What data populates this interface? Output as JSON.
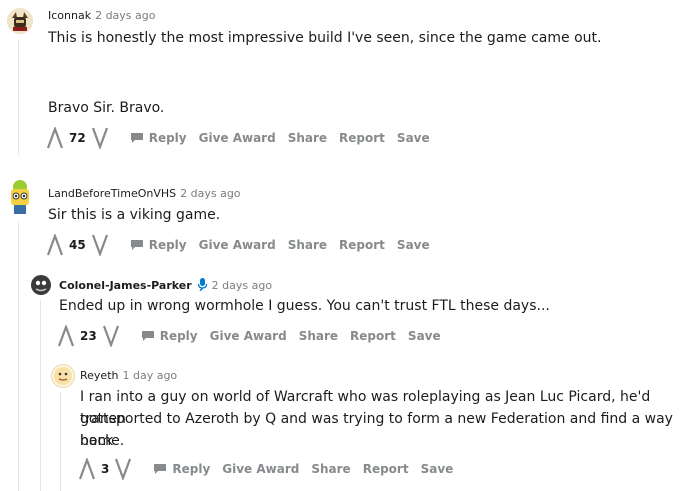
{
  "comments": [
    {
      "author": "Iconnak",
      "time": "2 days ago",
      "lines": [
        "This is honestly the most impressive build I've seen, since the game came out.",
        "Bravo Sir. Bravo."
      ],
      "score": "72"
    },
    {
      "author": "LandBeforeTimeOnVHS",
      "time": "2 days ago",
      "lines": [
        "Sir this is a viking game."
      ],
      "score": "45"
    },
    {
      "author": "Colonel-James-Parker",
      "time": "2 days ago",
      "lines": [
        "Ended up in wrong wormhole I guess. You can't trust FTL these days..."
      ],
      "score": "23"
    },
    {
      "author": "Reyeth",
      "time": "1 day ago",
      "lines": [
        "I ran into a guy on world of Warcraft who was roleplaying as Jean Luc Picard, he'd gotten",
        "transported to Azeroth by Q and was trying to form a new Federation and find a way back",
        "home."
      ],
      "score": "3"
    }
  ],
  "actions": {
    "reply": "Reply",
    "give_award": "Give Award",
    "share": "Share",
    "report": "Report",
    "save": "Save"
  }
}
